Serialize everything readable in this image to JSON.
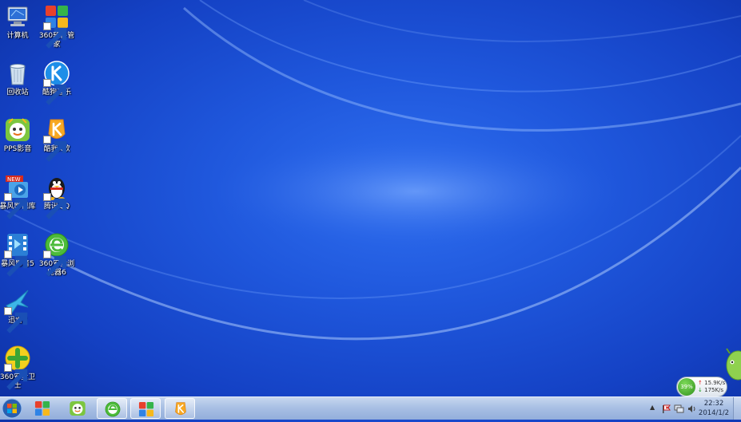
{
  "desktop": {
    "icons": [
      {
        "label": "计算机",
        "icon": "computer-icon"
      },
      {
        "label": "360软件管家",
        "icon": "360-software-manager-icon"
      },
      {
        "label": "回收站",
        "icon": "recycle-bin-icon"
      },
      {
        "label": "酷狗音乐",
        "icon": "kugou-music-icon"
      },
      {
        "label": "PPS影音",
        "icon": "pps-player-icon"
      },
      {
        "label": "酷我K歌",
        "icon": "kuwo-karaoke-icon"
      },
      {
        "label": "暴风影视库",
        "icon": "baofeng-video-library-icon"
      },
      {
        "label": "腾讯QQ",
        "icon": "qq-penguin-icon"
      },
      {
        "label": "暴风影音5",
        "icon": "baofeng-player-icon"
      },
      {
        "label": "360安全浏览器6",
        "icon": "360-browser-icon"
      },
      {
        "label": "迅雷7",
        "icon": "xunlei-bird-icon"
      },
      {
        "label": "360安全卫士",
        "icon": "360-security-guard-icon"
      }
    ],
    "badge_new": "NEW"
  },
  "widget": {
    "percent": "39%",
    "upload": "15.9K/s",
    "download": "175K/s",
    "colors": {
      "ring": "#2f8f1d",
      "up_arrow": "#dd2222",
      "down_arrow": "#1a9b1a"
    }
  },
  "taskbar": {
    "pinned": [
      {
        "name": "360-software-manager",
        "icon": "360-software-manager-icon",
        "active": false
      },
      {
        "name": "pps-player",
        "icon": "pps-player-icon",
        "active": false
      },
      {
        "name": "360-browser",
        "icon": "360-browser-icon",
        "active": true
      },
      {
        "name": "360-software-manager-2",
        "icon": "360-software-manager-icon",
        "active": true
      },
      {
        "name": "kuwo-karaoke",
        "icon": "kuwo-karaoke-icon",
        "active": true
      }
    ],
    "clock": {
      "time": "22:32",
      "date": "2014/1/2"
    },
    "tray_icons": [
      "show-hidden-icons-icon",
      "action-center-flag-icon",
      "network-icon",
      "volume-icon"
    ]
  },
  "theme": {
    "desktop_blue": "#1f57dc",
    "taskbar": "#a9c0e4"
  }
}
